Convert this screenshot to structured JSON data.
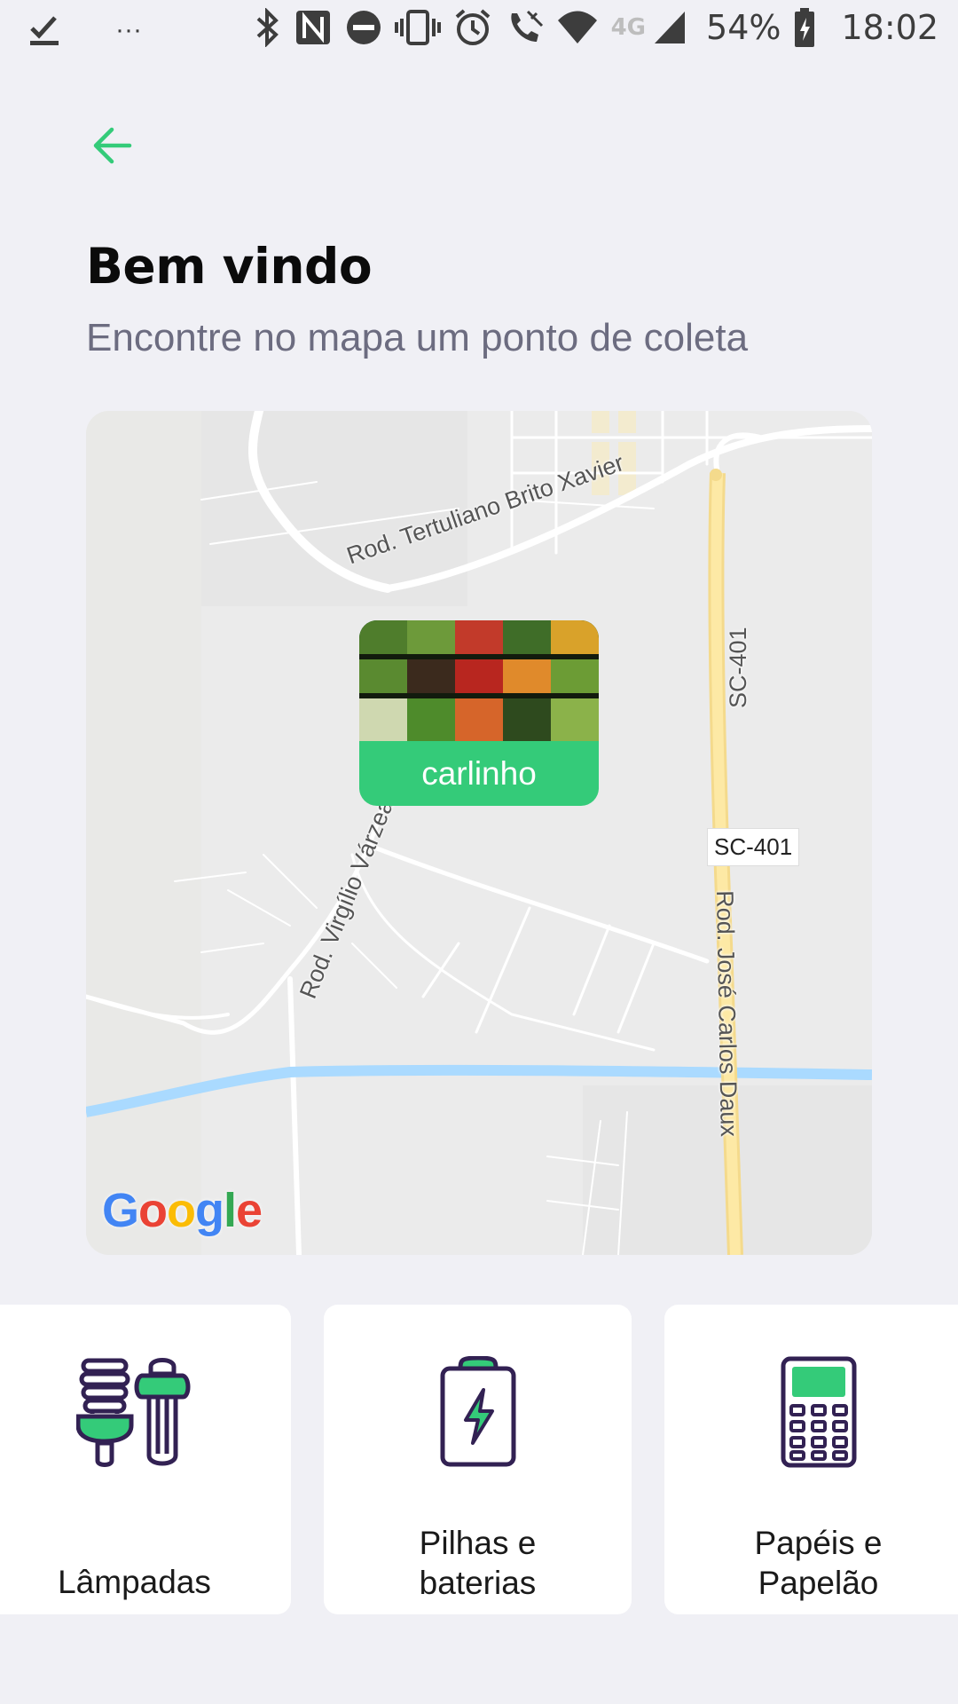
{
  "status_bar": {
    "battery": "54%",
    "time": "18:02",
    "network": "4G",
    "more": "···"
  },
  "header": {
    "title": "Bem vindo",
    "subtitle": "Encontre no mapa um ponto de coleta"
  },
  "map": {
    "labels": {
      "road1": "Rod. Tertuliano Brito Xavier",
      "road2": "SC-401",
      "road3": "Rod. Virgílio Várzea",
      "road4": "Rod. José Carlos Daux",
      "shield": "SC-401"
    },
    "marker": {
      "name": "carlinho"
    },
    "attribution": "Google"
  },
  "items": [
    {
      "line1": "Lâmpadas",
      "line2": ""
    },
    {
      "line1": "Pilhas e",
      "line2": "baterias"
    },
    {
      "line1": "Papéis e",
      "line2": "Papelão"
    }
  ],
  "colors": {
    "accent": "#34cb79",
    "icon_dark": "#322153",
    "background": "#f0f0f5"
  }
}
